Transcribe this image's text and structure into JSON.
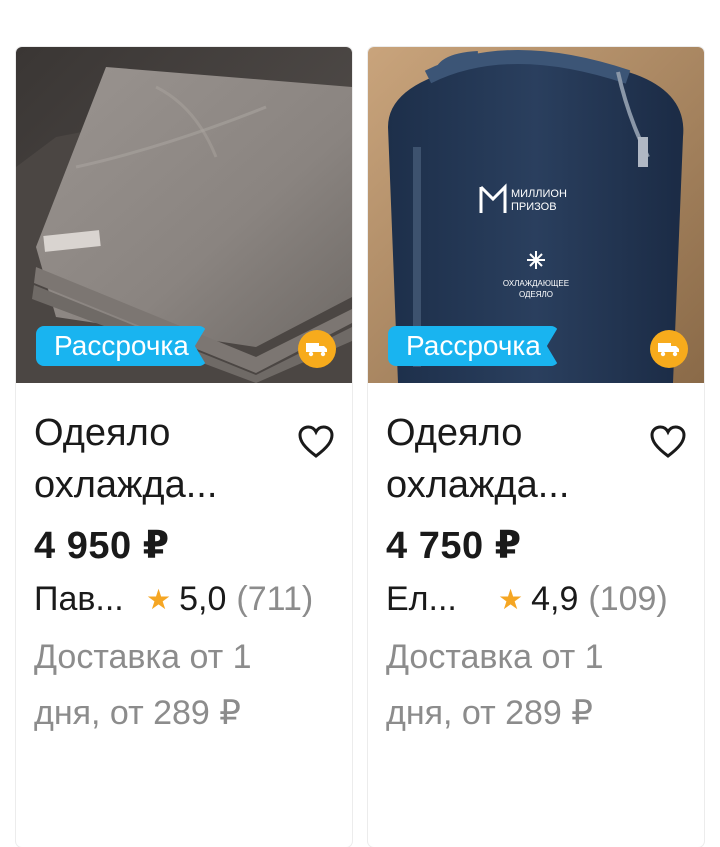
{
  "products": [
    {
      "badge": "Рассрочка",
      "title_line1": "Одеяло",
      "title_line2": "охлажда...",
      "price": "4 950 ₽",
      "seller": "Пав...",
      "rating": "5,0",
      "reviews": "(711)",
      "delivery_line1": "Доставка от 1",
      "delivery_line2": "дня, от 289 ₽"
    },
    {
      "badge": "Рассрочка",
      "title_line1": "Одеяло",
      "title_line2": "охлажда...",
      "price": "4 750 ₽",
      "seller": "Ел...",
      "rating": "4,9",
      "reviews": "(109)",
      "delivery_line1": "Доставка от 1",
      "delivery_line2": "дня, от 289 ₽",
      "bag_print": [
        "МИЛЛИОН",
        "ПРИЗОВ",
        "ОХЛАЖДАЮЩЕЕ",
        "ОДЕЯЛО"
      ]
    }
  ],
  "icons": {
    "favorite": "heart-outline-icon",
    "rating": "star-icon",
    "delivery": "truck-icon"
  },
  "colors": {
    "badge_bg": "#19b4f0",
    "truck_bg": "#f7ab1c",
    "star": "#f5a623",
    "muted_text": "#8c8c8c"
  }
}
